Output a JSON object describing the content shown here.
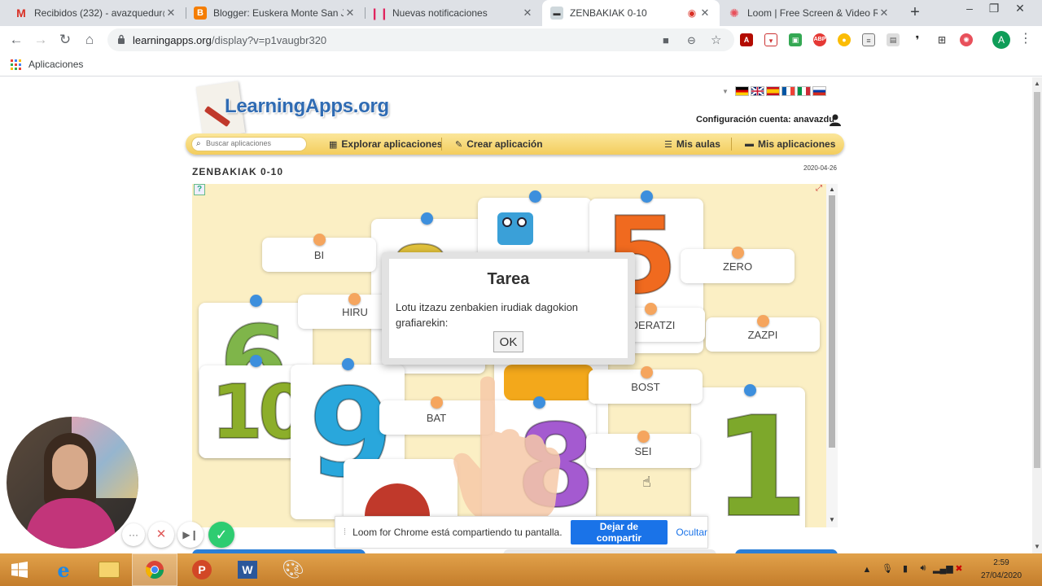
{
  "browser": {
    "tabs": [
      {
        "title": "Recibidos (232) - avazquedur@",
        "icon": "gmail-icon",
        "active": false
      },
      {
        "title": "Blogger: Euskera Monte San Juli",
        "icon": "blogger-icon",
        "active": false
      },
      {
        "title": "Nuevas notificaciones",
        "icon": "notifications-icon",
        "active": false
      },
      {
        "title": "ZENBAKIAK 0-10",
        "icon": "learningapps-icon",
        "active": true
      },
      {
        "title": "Loom | Free Screen & Video Rec",
        "icon": "loom-icon",
        "active": false
      }
    ],
    "url_host": "learningapps.org",
    "url_path": "/display?v=p1vaugbr320",
    "bookmarks_label": "Aplicaciones",
    "profile_initial": "A"
  },
  "site": {
    "logo": "LearningApps.org",
    "account_label": "Configuración cuenta: anavazdu",
    "search_placeholder": "Buscar aplicaciones",
    "menu": {
      "explore": "Explorar aplicaciones",
      "create": "Crear aplicación",
      "classes": "Mis aulas",
      "apps": "Mis aplicaciones"
    },
    "app_title": "ZENBAKIAK 0-10",
    "app_date": "2020-04-26"
  },
  "game": {
    "words": [
      "BI",
      "HIRU",
      "ZERO",
      "ZAZPI",
      "DERATZI",
      "BOST",
      "BAT",
      "SEI"
    ],
    "number_cards": [
      "10",
      "9",
      "5",
      "6",
      "1",
      "8"
    ]
  },
  "dialog": {
    "title": "Tarea",
    "message": "Lotu itzazu zenbakien irudiak dagokion grafiarekin:",
    "ok": "OK"
  },
  "loom": {
    "share_text": "Loom for Chrome está compartiendo tu pantalla.",
    "stop_label": "Dejar de compartir",
    "hide_label": "Ocultar"
  },
  "taskbar": {
    "time": "2:59",
    "date": "27/04/2020"
  },
  "colors": {
    "menubar": "#f3cd5d",
    "game_bg": "#fbefc4",
    "pin_blue": "#3d8fdd",
    "pin_orange": "#f5a55e",
    "loom_button": "#1a73e8",
    "taskbar": "#c47d2b"
  }
}
